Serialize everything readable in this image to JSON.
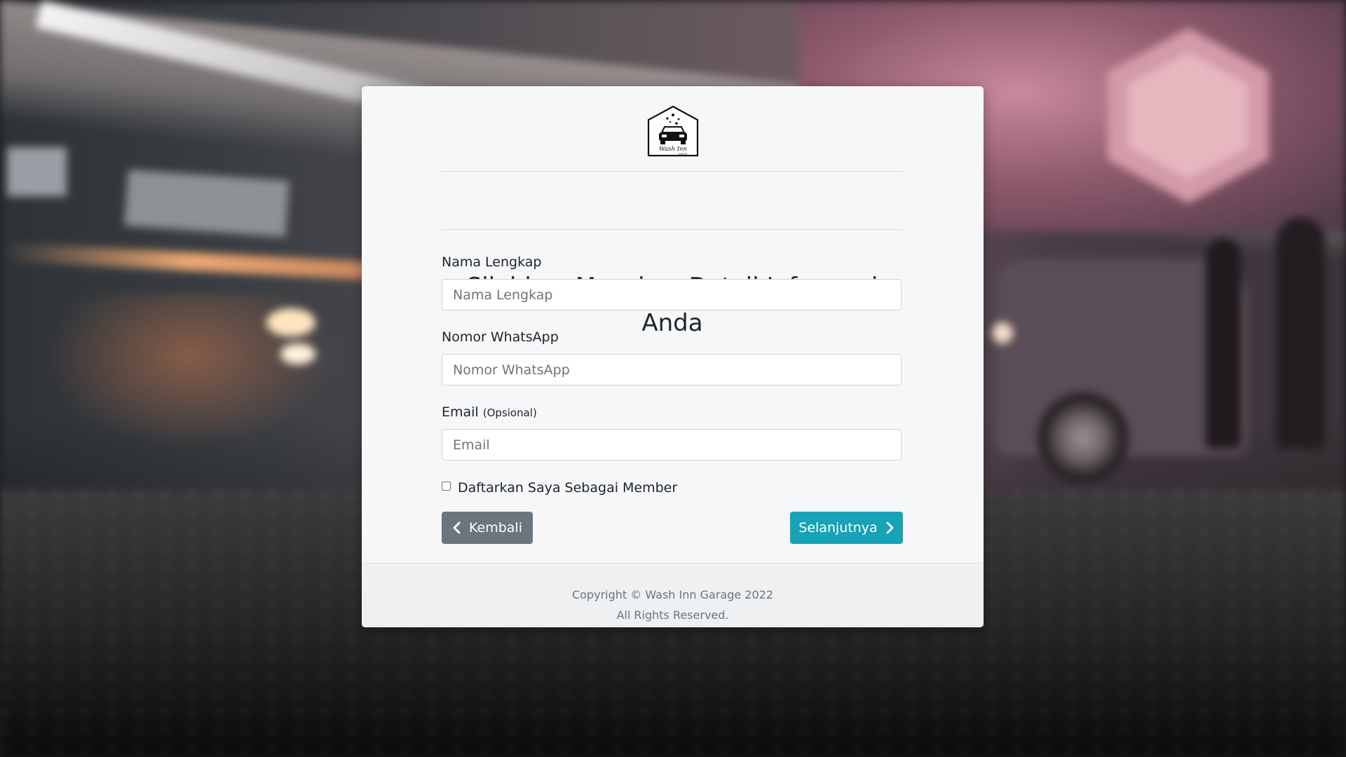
{
  "logo": {
    "text": "Wash Inn",
    "subtext": "GARAGE",
    "icon": "car-wash-logo-icon"
  },
  "form": {
    "title": "Silahkan Masukan Detail Informasi Anda",
    "name_label": "Nama Lengkap",
    "name_placeholder": "Nama Lengkap",
    "whatsapp_label": "Nomor WhatsApp",
    "whatsapp_placeholder": "Nomor WhatsApp",
    "email_label": "Email",
    "email_optional": "(Opsional)",
    "email_placeholder": "Email",
    "member_checkbox_label": "Daftarkan Saya Sebagai Member",
    "member_checked": false
  },
  "buttons": {
    "back_label": "Kembali",
    "back_icon": "chevron-left-icon",
    "next_label": "Selanjutnya",
    "next_icon": "chevron-right-icon"
  },
  "footer": {
    "copyright": "Copyright © Wash Inn Garage 2022",
    "rights": "All Rights Reserved."
  },
  "colors": {
    "card_bg": "#f5f7f9",
    "back_button": "#6c757d",
    "next_button": "#17a2b8",
    "text": "#212529",
    "muted": "#6c757d"
  }
}
